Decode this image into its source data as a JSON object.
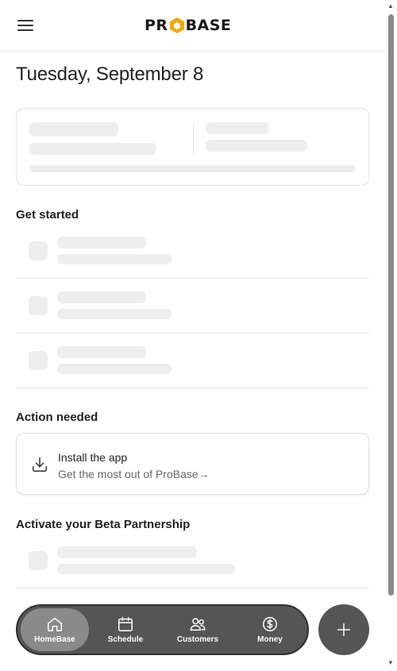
{
  "header": {
    "brand_left": "PR",
    "brand_right": "BASE"
  },
  "page": {
    "date_title": "Tuesday, September 8"
  },
  "sections": {
    "get_started": "Get started",
    "action_needed": "Action needed",
    "beta": "Activate your Beta Partnership"
  },
  "action_card": {
    "title": "Install the app",
    "subtitle": "Get the most out of ProBase→",
    "icon": "download-icon"
  },
  "nav": {
    "items": [
      {
        "label": "HomeBase",
        "icon": "home-icon"
      },
      {
        "label": "Schedule",
        "icon": "calendar-icon"
      },
      {
        "label": "Customers",
        "icon": "users-icon"
      },
      {
        "label": "Money",
        "icon": "dollar-icon"
      }
    ],
    "fab_icon": "plus-icon"
  },
  "colors": {
    "nav_bg": "#555555",
    "nav_active": "#8a8a8a",
    "skeleton": "#eeeeee",
    "brand_hex": "#f2a900",
    "progress": "#3b82f6"
  }
}
